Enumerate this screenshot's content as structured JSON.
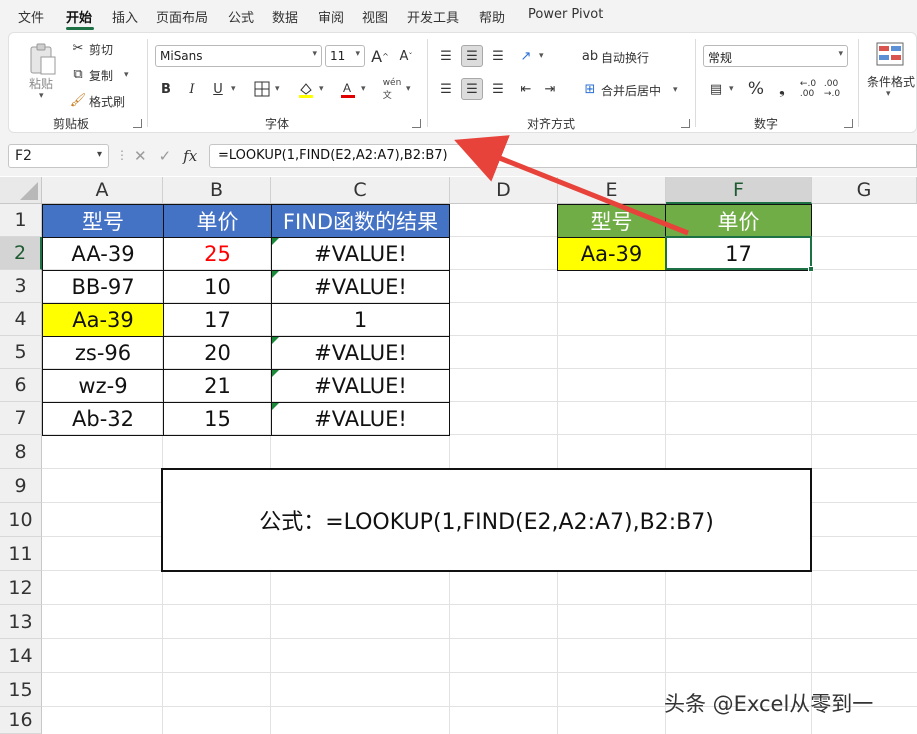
{
  "menu": {
    "tabs": [
      "文件",
      "开始",
      "插入",
      "页面布局",
      "公式",
      "数据",
      "审阅",
      "视图",
      "开发工具",
      "帮助",
      "Power Pivot"
    ],
    "active_tab": "开始"
  },
  "ribbon": {
    "clipboard": {
      "label": "剪贴板",
      "paste": "粘贴",
      "cut": "剪切",
      "copy": "复制",
      "format_painter": "格式刷"
    },
    "font": {
      "label": "字体",
      "font_name": "MiSans",
      "font_size": "11",
      "bold": "B",
      "italic": "I",
      "underline": "U"
    },
    "alignment": {
      "label": "对齐方式",
      "wrap_text": "自动换行",
      "merge_center": "合并后居中"
    },
    "number": {
      "label": "数字",
      "format": "常规"
    },
    "styles": {
      "conditional_format": "条件格式"
    }
  },
  "formula_bar": {
    "name_box": "F2",
    "fx_label": "fx",
    "formula": "=LOOKUP(1,FIND(E2,A2:A7),B2:B7)"
  },
  "sheet": {
    "columns": [
      "A",
      "B",
      "C",
      "D",
      "E",
      "F",
      "G"
    ],
    "rows": [
      "1",
      "2",
      "3",
      "4",
      "5",
      "6",
      "7",
      "8",
      "9",
      "10",
      "11",
      "12",
      "13",
      "14",
      "15",
      "16"
    ],
    "selected_cell": "F2",
    "table_headers": [
      "型号",
      "单价",
      "FIND函数的结果"
    ],
    "table_rows": [
      {
        "model": "AA-39",
        "price": "25",
        "find_result": "#VALUE!"
      },
      {
        "model": "BB-97",
        "price": "10",
        "find_result": "#VALUE!"
      },
      {
        "model": "Aa-39",
        "price": "17",
        "find_result": "1"
      },
      {
        "model": "zs-96",
        "price": "20",
        "find_result": "#VALUE!"
      },
      {
        "model": "wz-9",
        "price": "21",
        "find_result": "#VALUE!"
      },
      {
        "model": "Ab-32",
        "price": "15",
        "find_result": "#VALUE!"
      }
    ],
    "lookup_headers": [
      "型号",
      "单价"
    ],
    "lookup_model": "Aa-39",
    "lookup_result": "17",
    "note": "公式：=LOOKUP(1,FIND(E2,A2:A7),B2:B7)"
  },
  "colors": {
    "header_blue": "#4472c4",
    "header_green": "#70ad47",
    "highlight_yellow": "#ffff00",
    "error_red": "#ff0000",
    "annotation_arrow": "#e8433a",
    "excel_green": "#1e7145"
  },
  "watermark": "头条 @Excel从零到一"
}
